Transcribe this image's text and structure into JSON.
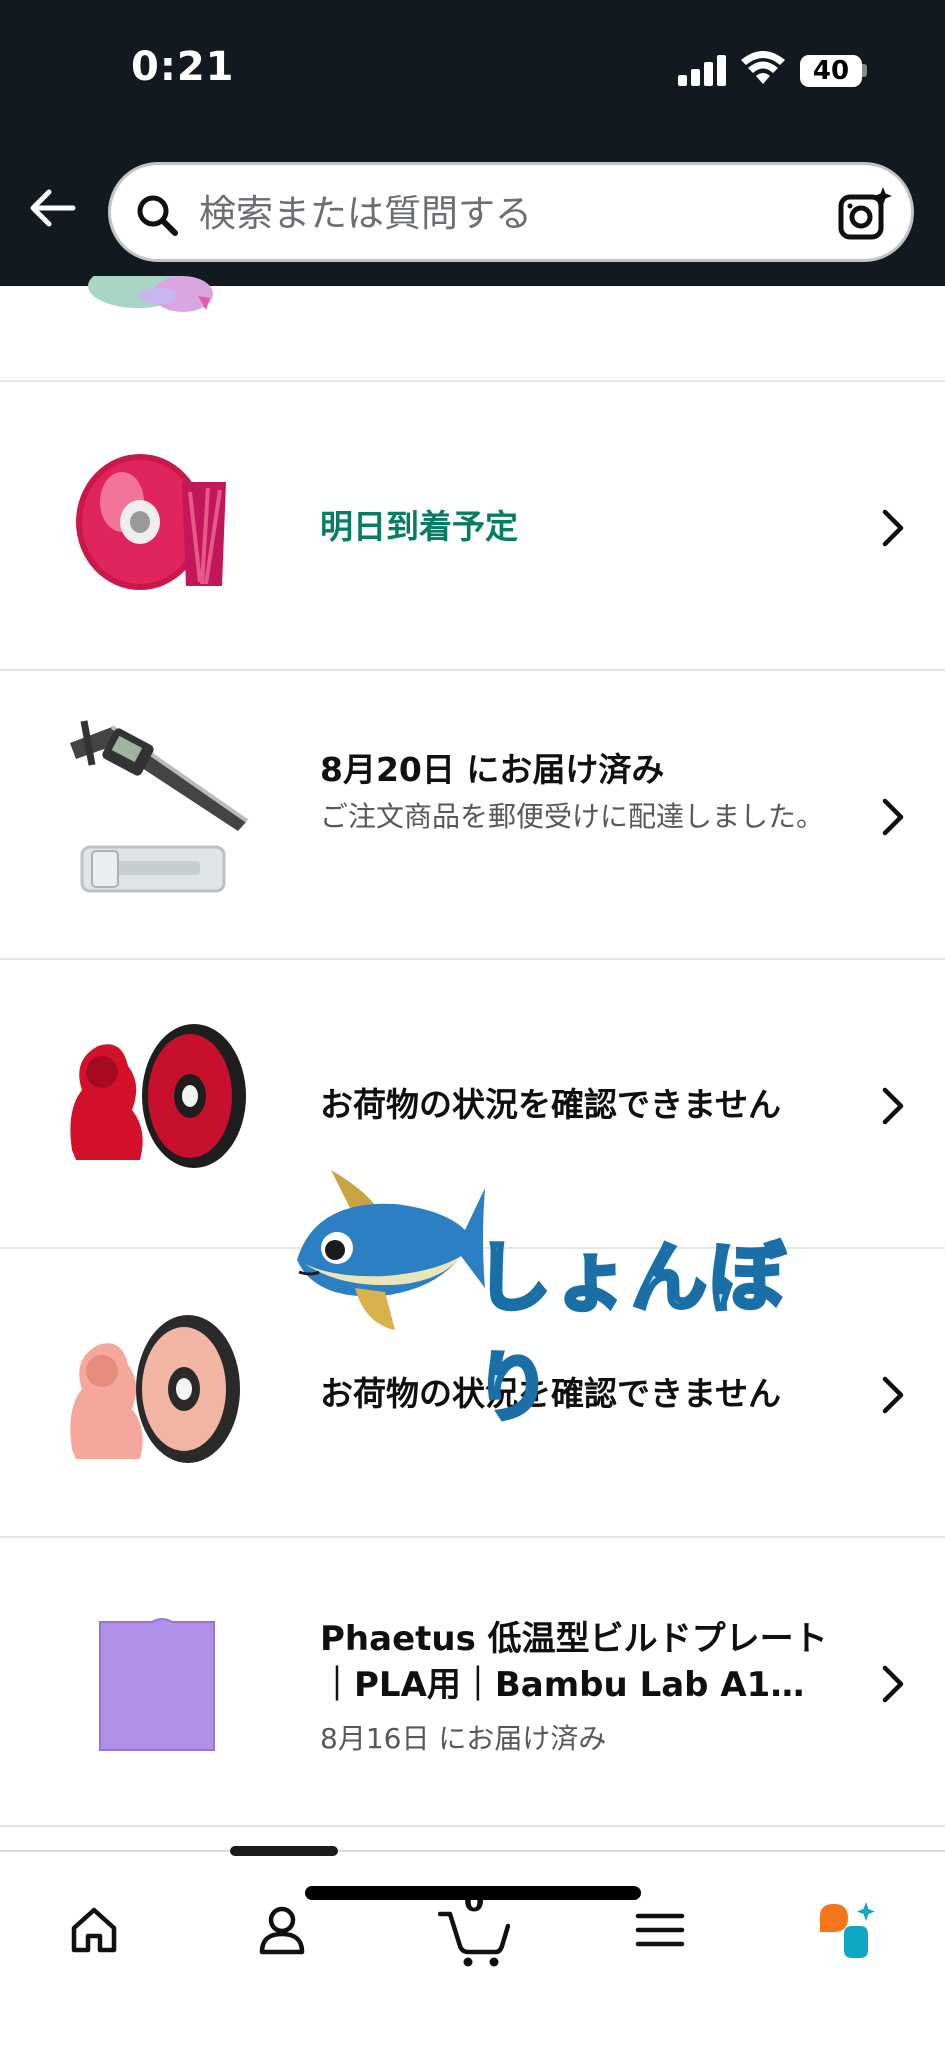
{
  "status_bar": {
    "time": "0:21",
    "battery": "40"
  },
  "search": {
    "placeholder": "検索または質問する"
  },
  "orders": [
    {
      "title": "明日到着予定",
      "subtitle": "",
      "title_color": "#067d62",
      "thumb": "red-silk-filament-spool"
    },
    {
      "title": "8月20日 にお届け済み",
      "subtitle": "ご注文商品を郵便受けに配達しました。",
      "thumb": "digital-caliper"
    },
    {
      "title": "お荷物の状況を確認できません",
      "subtitle": "",
      "thumb": "red-filament-spool-with-lion"
    },
    {
      "title": "お荷物の状況を確認できません",
      "subtitle": "",
      "thumb": "pink-filament-spool-with-lion"
    },
    {
      "title": "Phaetus 低温型ビルドプレート｜PLA用｜Bambu Lab A1…",
      "subtitle": "8月16日 にお届け済み",
      "thumb": "purple-build-plate"
    }
  ],
  "sticker": {
    "text": "しょんぼり"
  },
  "bottom_nav": {
    "items": [
      "home-icon",
      "account-icon",
      "cart-icon",
      "menu-icon",
      "rufus-icon"
    ],
    "cart_count": "0"
  },
  "colors": {
    "header_bg": "#131921",
    "green": "#067d62",
    "accent_orange": "#f5751b",
    "accent_teal": "#0fa8c4"
  }
}
